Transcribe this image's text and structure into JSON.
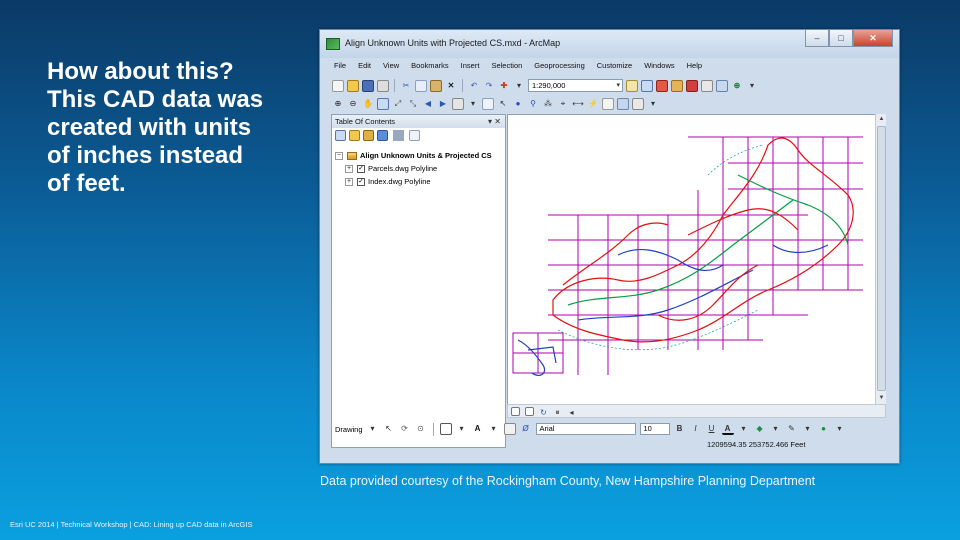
{
  "slide": {
    "headline_lines": [
      "How about this?",
      "This CAD data was",
      "created with units",
      "of inches instead",
      "of feet."
    ],
    "caption": "Data provided courtesy of the Rockingham County, New Hampshire Planning Department",
    "footer": "Esri UC 2014 | Technical Workshop | CAD: Lining up CAD data in ArcGIS"
  },
  "window": {
    "title": "Align Unknown Units with Projected CS.mxd - ArcMap",
    "controls": {
      "minimize": "–",
      "maximize": "□",
      "close": "✕"
    },
    "menu": [
      "File",
      "Edit",
      "View",
      "Bookmarks",
      "Insert",
      "Selection",
      "Geoprocessing",
      "Customize",
      "Windows",
      "Help"
    ],
    "scale": "1:290,000",
    "toc": {
      "title": "Table Of Contents",
      "pin": "▾ ✕",
      "frame": "Align Unknown Units & Projected CS",
      "layers": [
        {
          "name": "Parcels.dwg Polyline",
          "checked": "✓"
        },
        {
          "name": "Index.dwg Polyline",
          "checked": "✓"
        }
      ]
    },
    "drawing": {
      "menu": "Drawing",
      "font": "Arial",
      "size": "10",
      "bold": "B",
      "italic": "I",
      "underline": "U",
      "font_color_letter": "A"
    },
    "coordinates": "1209594.35  253752.466 Feet"
  },
  "icons": {
    "colors": {
      "grid": "#b000b0",
      "parcels_red": "#e01010",
      "parcels_green": "#00a040",
      "index_blue": "#2040c0"
    }
  }
}
